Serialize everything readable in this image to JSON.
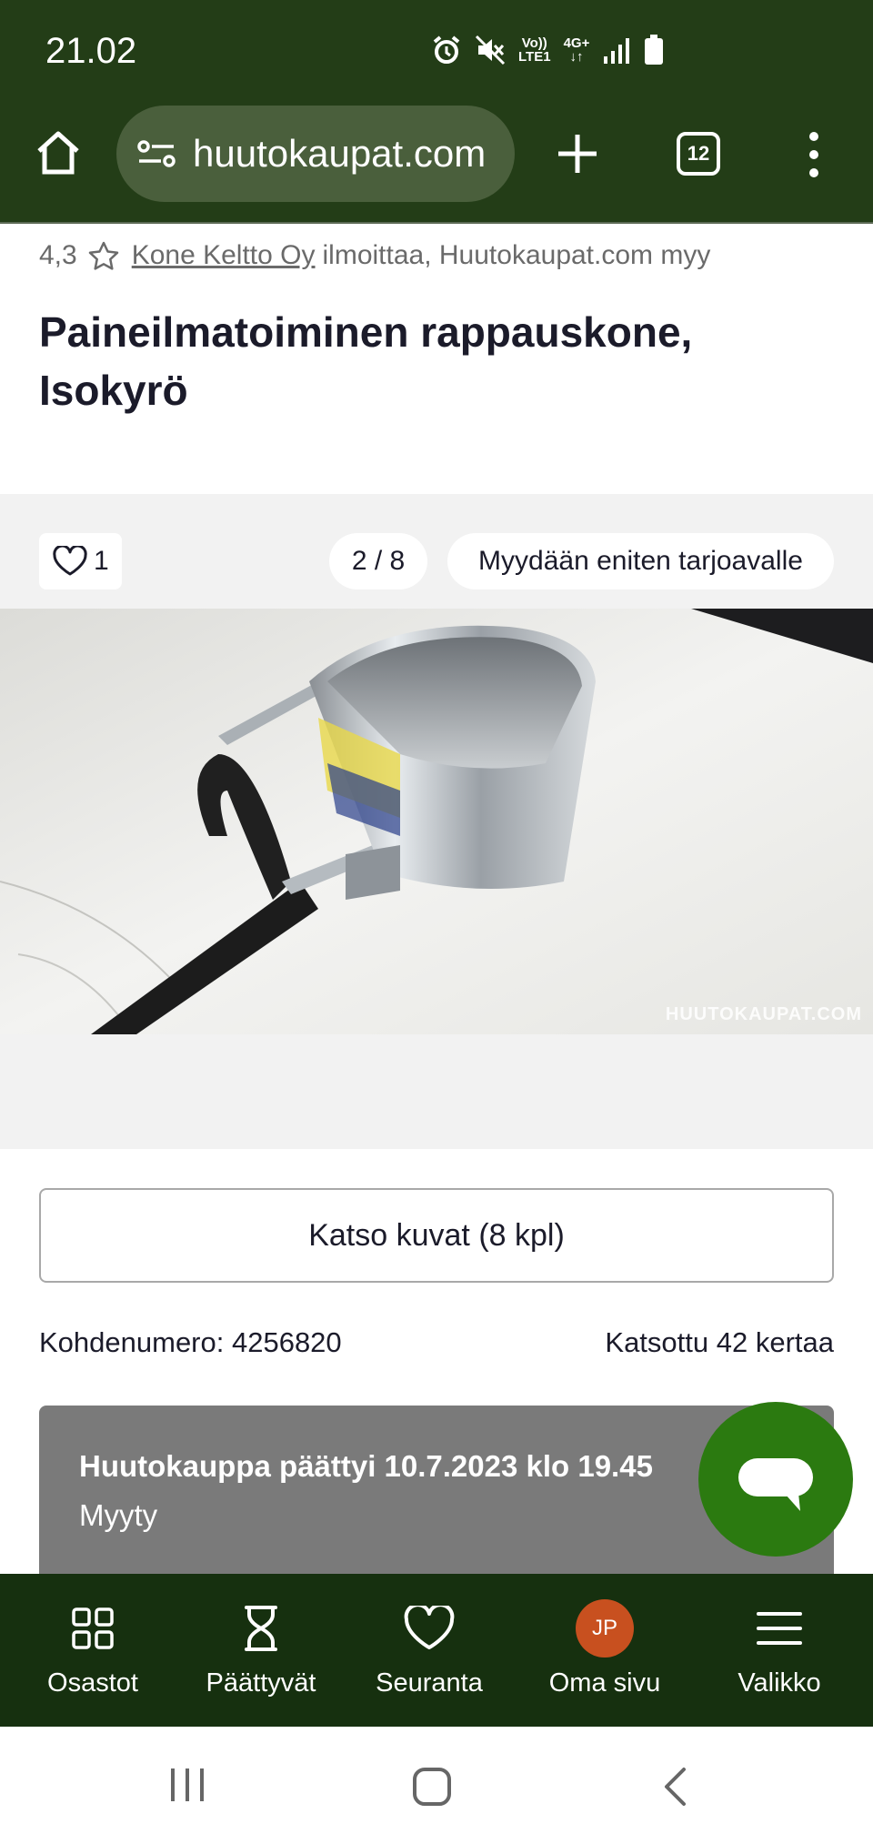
{
  "status_bar": {
    "time": "21.02",
    "network_top": "Vo))",
    "network_bottom": "LTE1",
    "network_type": "4G+"
  },
  "browser": {
    "url": "huutokaupat.com",
    "tab_count": "12"
  },
  "listing": {
    "rating": "4,3",
    "seller_link": "Kone Keltto Oy",
    "seller_suffix": "ilmoittaa, Huutokaupat.com myy",
    "title": "Paineilmatoiminen rappauskone, Isokyrö"
  },
  "gallery": {
    "favorites_count": "1",
    "image_counter": "2 / 8",
    "sale_type": "Myydään eniten tarjoavalle",
    "watermark": "HUUTOKAUPAT.COM"
  },
  "actions": {
    "view_images_label": "Katso kuvat (8 kpl)"
  },
  "meta": {
    "item_number": "Kohdenumero: 4256820",
    "views": "Katsottu 42 kertaa"
  },
  "auction": {
    "ended_text": "Huutokauppa päättyi 10.7.2023 klo 19.45",
    "status": "Myyty"
  },
  "bottom_nav": {
    "items": [
      {
        "label": "Osastot",
        "icon": "grid-icon"
      },
      {
        "label": "Päättyvät",
        "icon": "hourglass-icon"
      },
      {
        "label": "Seuranta",
        "icon": "heart-icon"
      },
      {
        "label": "Oma sivu",
        "icon": "avatar"
      },
      {
        "label": "Valikko",
        "icon": "menu-icon"
      }
    ],
    "avatar_initials": "JP"
  },
  "colors": {
    "header_green": "#233d17",
    "nav_green": "#16300f",
    "fab_green": "#2b7a10",
    "avatar_orange": "#c8501f",
    "card_gray": "#7a7a7a"
  }
}
